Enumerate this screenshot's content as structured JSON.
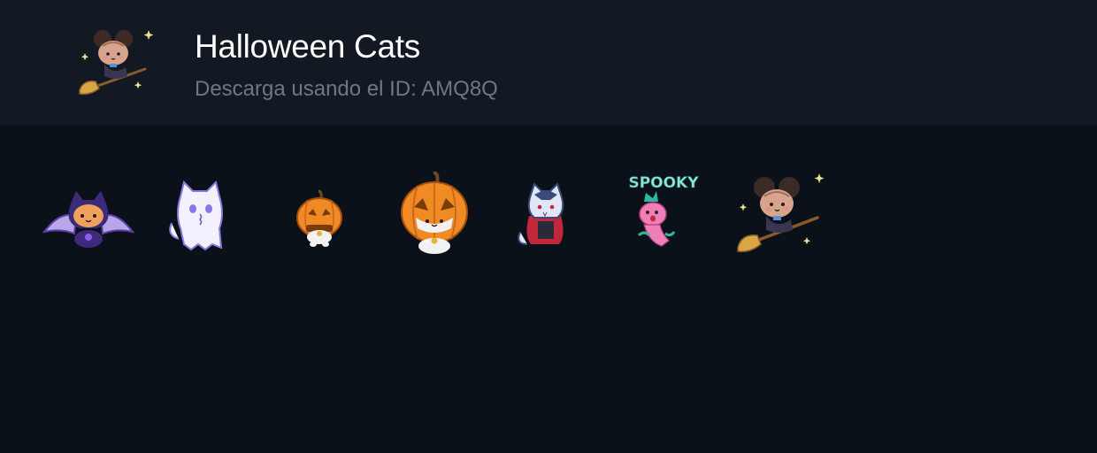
{
  "pack": {
    "title": "Halloween Cats",
    "subtitle": "Descarga usando el ID: AMQ8Q",
    "cover_icon": "witch-cat-on-broom-icon"
  },
  "stickers": [
    {
      "name": "bat-cat-sticker"
    },
    {
      "name": "ghost-cat-sticker"
    },
    {
      "name": "small-pumpkin-cat-sticker"
    },
    {
      "name": "large-pumpkin-cat-sticker"
    },
    {
      "name": "vampire-cat-sticker"
    },
    {
      "name": "spooky-cat-sticker",
      "text": "SPOOKY"
    },
    {
      "name": "witch-cat-on-broom-sticker"
    }
  ],
  "colors": {
    "background": "#0b1118",
    "header_background": "#121922",
    "title": "#ffffff",
    "subtitle": "#6f7780"
  }
}
